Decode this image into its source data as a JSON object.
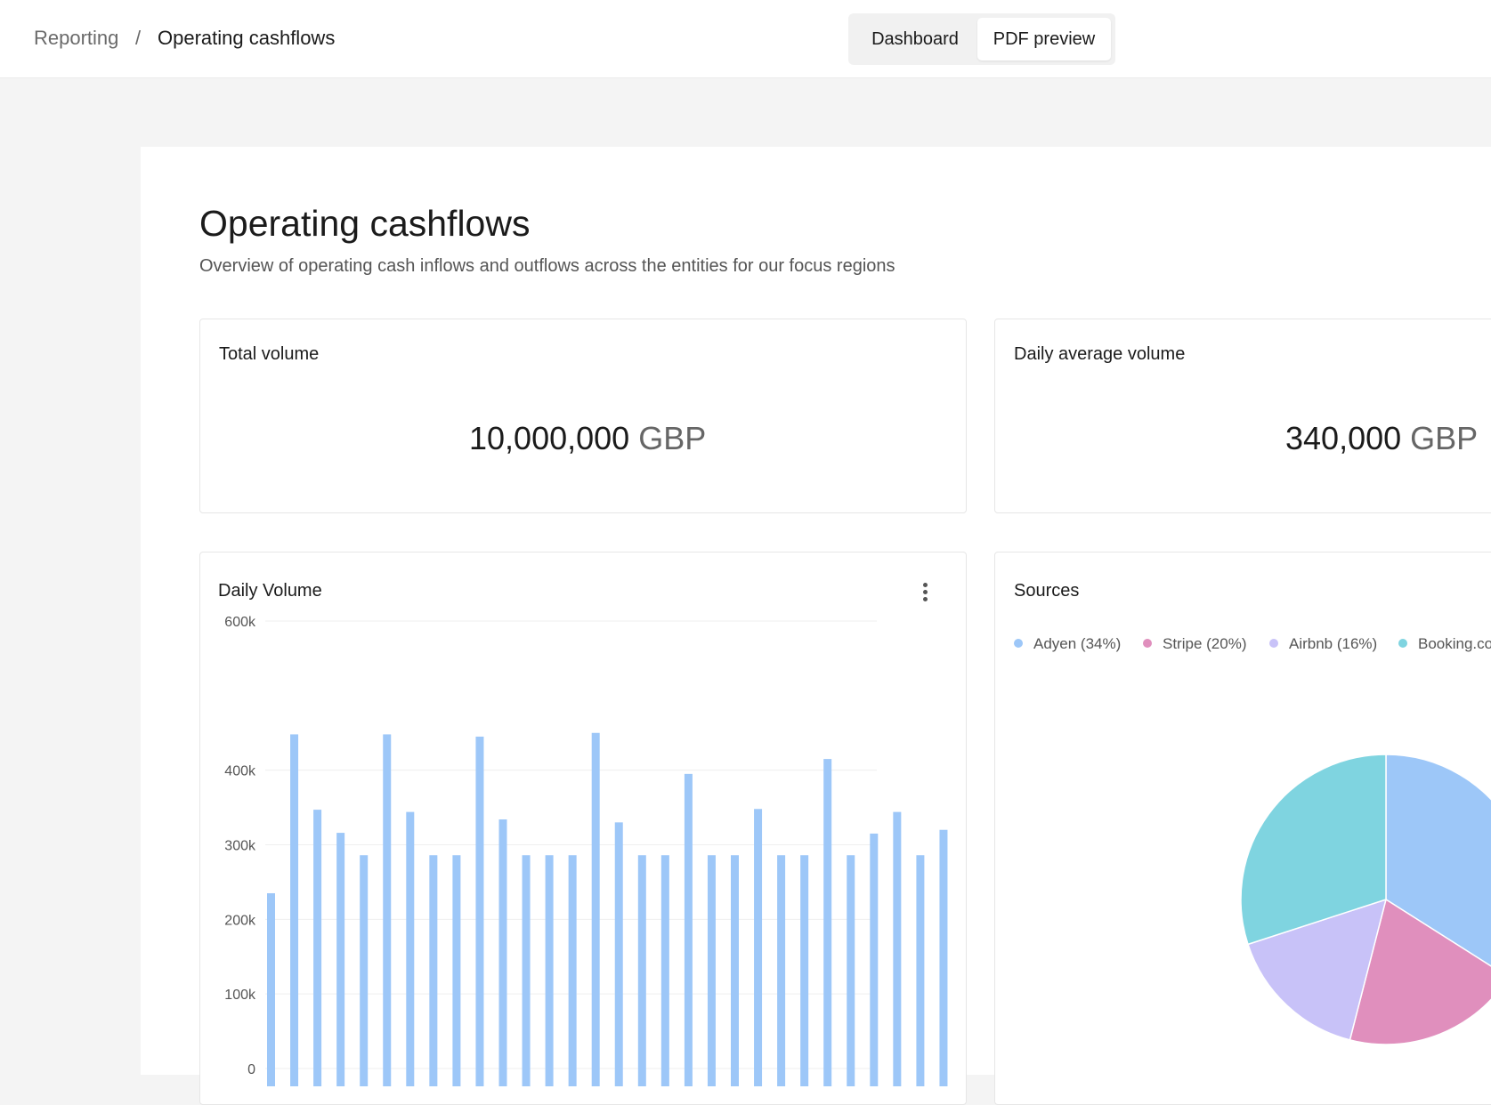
{
  "breadcrumb": {
    "root": "Reporting",
    "separator": "/",
    "current": "Operating cashflows"
  },
  "view_toggle": {
    "options": [
      "Dashboard",
      "PDF preview"
    ],
    "selected": "PDF preview"
  },
  "page": {
    "title": "Operating cashflows",
    "subtitle": "Overview of operating cash inflows and outflows across the entities for our focus regions"
  },
  "kpis": [
    {
      "title": "Total volume",
      "value": "10,000,000",
      "unit": "GBP"
    },
    {
      "title": "Daily average volume",
      "value": "340,000",
      "unit": "GBP"
    }
  ],
  "daily_volume": {
    "title": "Daily Volume",
    "menu_icon": "kebab-icon"
  },
  "sources": {
    "title": "Sources",
    "legend": [
      {
        "label": "Adyen (34%)",
        "color": "#9dc7f8"
      },
      {
        "label": "Stripe (20%)",
        "color": "#e08fbd"
      },
      {
        "label": "Airbnb (16%)",
        "color": "#c8c2f8"
      },
      {
        "label": "Booking.co",
        "color": "#7fd4e0"
      }
    ]
  },
  "chart_data": [
    {
      "type": "bar",
      "title": "Daily Volume",
      "ylim": [
        0,
        600000
      ],
      "y_ticks": [
        "0",
        "100k",
        "200k",
        "300k",
        "400k",
        "600k"
      ],
      "bar_color": "#9dc7f8",
      "values": [
        235000,
        448000,
        347000,
        316000,
        286000,
        448000,
        344000,
        286000,
        286000,
        445000,
        334000,
        286000,
        286000,
        286000,
        450000,
        330000,
        286000,
        286000,
        395000,
        286000,
        286000,
        348000,
        286000,
        286000,
        415000,
        286000,
        315000,
        344000,
        286000,
        320000
      ]
    },
    {
      "type": "pie",
      "title": "Sources",
      "series": [
        {
          "name": "Adyen",
          "value": 34,
          "color": "#9dc7f8"
        },
        {
          "name": "Stripe",
          "value": 20,
          "color": "#e08fbd"
        },
        {
          "name": "Airbnb",
          "value": 16,
          "color": "#c8c2f8"
        },
        {
          "name": "Booking.co",
          "value": 30,
          "color": "#7fd4e0"
        }
      ]
    }
  ]
}
